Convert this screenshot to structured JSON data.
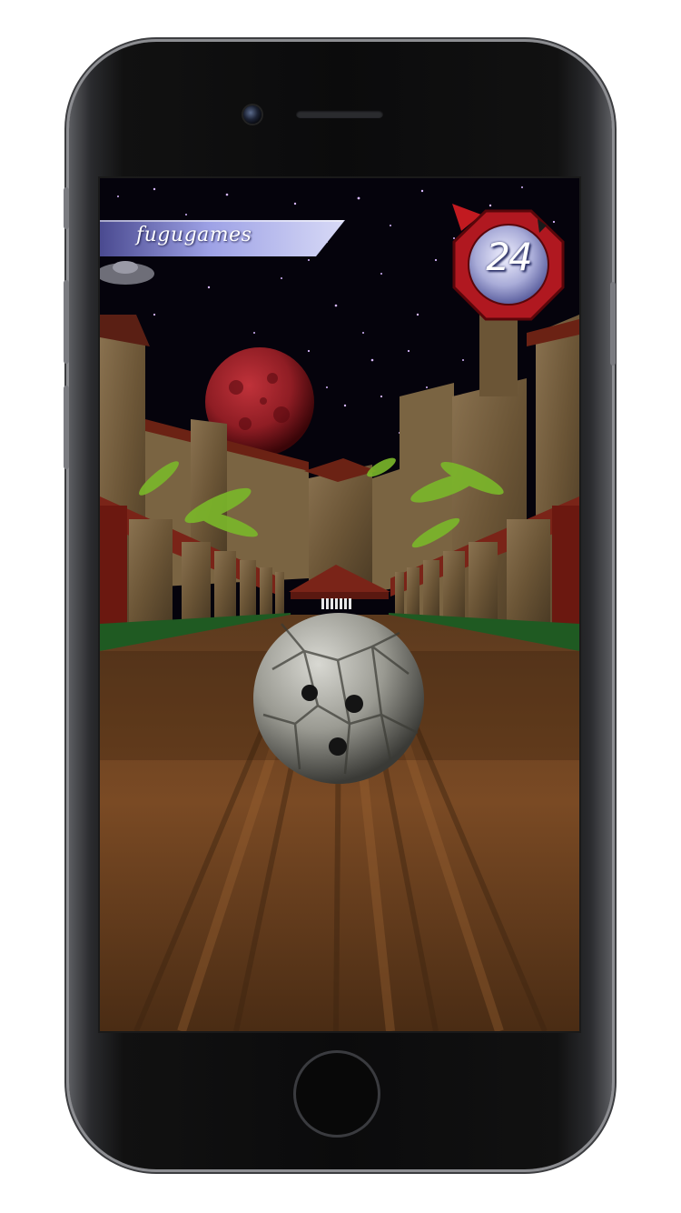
{
  "hud": {
    "player_name": "fugugames",
    "timer_value": "24"
  },
  "colors": {
    "lane_wood": "#7a4a24",
    "sky": "#05030c",
    "planet": "#8f1d24",
    "timer_ring": "#b01820",
    "banner": "#8c90d8"
  }
}
